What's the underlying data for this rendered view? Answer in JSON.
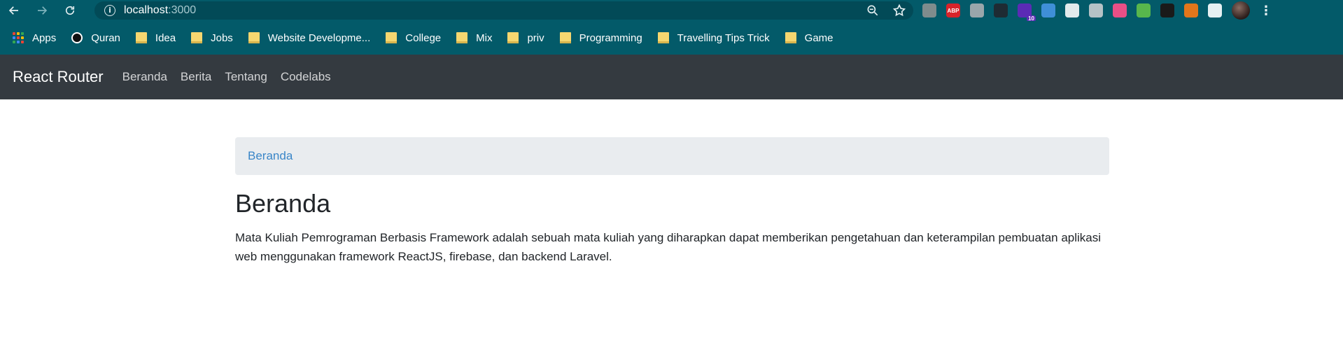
{
  "browser": {
    "url_host": "localhost",
    "url_port": ":3000",
    "extensions": [
      {
        "name": "globe-extension-icon",
        "color": "#7f8c8d"
      },
      {
        "name": "adblock-plus-icon",
        "color": "#d8232a",
        "label": "ABP"
      },
      {
        "name": "chat-extension-icon",
        "color": "#9aa6ab"
      },
      {
        "name": "spy-extension-icon",
        "color": "#1e2b33"
      },
      {
        "name": "gem-extension-icon",
        "color": "#5b2bb5",
        "badge": "10"
      },
      {
        "name": "download-extension-icon",
        "color": "#3f8fd8"
      },
      {
        "name": "document-extension-icon",
        "color": "#e3eaec"
      },
      {
        "name": "camera-extension-icon",
        "color": "#b5c2c6"
      },
      {
        "name": "color-picker-extension-icon",
        "color": "#e94f86"
      },
      {
        "name": "earth-extension-icon",
        "color": "#58b64c"
      },
      {
        "name": "ninja-extension-icon",
        "color": "#1a1a1a"
      },
      {
        "name": "metamask-extension-icon",
        "color": "#e2761b"
      },
      {
        "name": "puzzle-extensions-icon",
        "color": "#e6f0f2"
      }
    ]
  },
  "bookmarks": [
    {
      "label": "Apps",
      "icon": "apps-grid-icon"
    },
    {
      "label": "Quran",
      "icon": "quran-icon"
    },
    {
      "label": "Idea",
      "icon": "folder-icon"
    },
    {
      "label": "Jobs",
      "icon": "folder-icon"
    },
    {
      "label": "Website Developme...",
      "icon": "folder-icon"
    },
    {
      "label": "College",
      "icon": "folder-icon"
    },
    {
      "label": "Mix",
      "icon": "folder-icon"
    },
    {
      "label": "priv",
      "icon": "folder-icon"
    },
    {
      "label": "Programming",
      "icon": "folder-icon"
    },
    {
      "label": "Travelling Tips Trick",
      "icon": "folder-icon"
    },
    {
      "label": "Game",
      "icon": "folder-icon"
    }
  ],
  "navbar": {
    "brand": "React Router",
    "links": [
      "Beranda",
      "Berita",
      "Tentang",
      "Codelabs"
    ]
  },
  "breadcrumb": {
    "current": "Beranda"
  },
  "main": {
    "title": "Beranda",
    "description": "Mata Kuliah Pemrograman Berbasis Framework adalah sebuah mata kuliah yang diharapkan dapat memberikan pengetahuan dan keterampilan pembuatan aplikasi web menggunakan framework ReactJS, firebase, dan backend Laravel."
  },
  "colors": {
    "chrome_bg": "#035a69",
    "navbar_bg": "#343a40",
    "breadcrumb_bg": "#e9ecef",
    "link": "#3a86c8"
  }
}
